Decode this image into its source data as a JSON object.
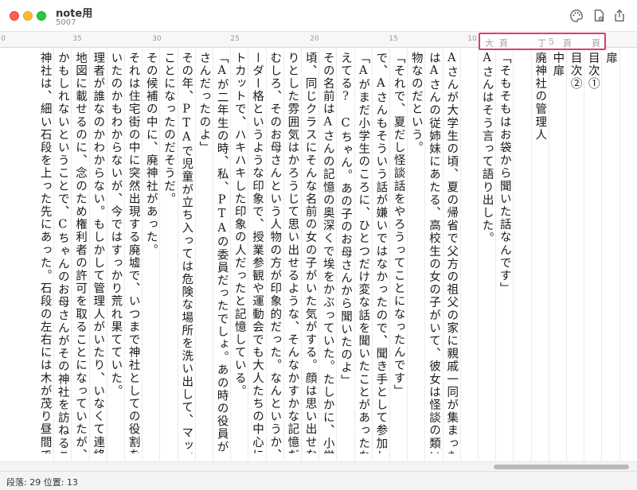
{
  "window": {
    "title": "note用",
    "subtitle": "5007"
  },
  "toolbar": {
    "icons": [
      "palette-icon",
      "document-settings-icon",
      "share-icon"
    ]
  },
  "ruler": {
    "ticks": [
      "0",
      "35",
      "30",
      "25",
      "20",
      "15",
      "10"
    ]
  },
  "page_header": {
    "items": [
      "大",
      "頁",
      "丁",
      "5",
      "頁",
      "頁"
    ]
  },
  "columns": [
    "扉",
    "目次①",
    "目次②",
    "中扉",
    "廃神社の管理人",
    "",
    "「そもそもはお袋から聞いた話なんです」",
    "Aさんはそう言って語り出した。",
    "",
    "Aさんが大学生の頃、夏の帰省で父方の祖父の家に親戚一同が集まった。その中に",
    "はAさんの従姉妹にあたる、高校生の女の子がいて、彼女は怪談の類いのものが大好",
    "物なのだという。",
    "「それで、夏だし怪談話をやろうってことになったんです」",
    "で、Aさんもそういう話が嫌いではなかったので、聞き手として参加した。何番目か",
    "「Aがまだ小学生のころに、ひとつだけ変な話を聞いたことがあったな。ほらA、覚",
    "えてる?　Cちゃん。あの子のお母さんから聞いたのよ」",
    "その名前はAさんの記憶の奥深くで埃をかぶっていた。たしかに、小学校低学年の",
    "頃、同じクラスにそんな名前の女の子がいた気がする。顔は思い出せないが、ぼんや",
    "りとした雰囲気はかろうじて思い出せるような、そんなかすかな記憶だ。",
    "むしろ、そのお母さんという人物の方が印象的だった。なんというか、親たちのリ",
    "ーダー格というような印象で、授業参観や運動会でも大人たちの中心にいた。ショー",
    "トカットで、ハキハキした印象の人だったと記憶している。",
    "「Aが二年生の時、私、PTAの委員だったでしょ。あの時の役員がCちゃんのお母",
    "さんだったのよ」",
    "その年、PTAで児童が立ち入っては危険な場所を洗い出して、マップを作成する",
    "ことになったのだそうだ。",
    "その候補の中に、廃神社があった。",
    "それは住宅街の中に突然出現する廃墟で、いつまで神社としての役割を果たして",
    "いたのかもわからないが、今ではすっかり荒れ果てていた。",
    "理者が誰なのかわからない。もしかして管理人がいたり、いなくて連絡先がわかる",
    "地図に載せるのに、念のため権利者の許可を取ることになっていたが、神社の管",
    "かもしれないということで、Cちゃんのお母さんがその神社を訪ねることになった。",
    "神社は、細い石段を上った先にあった。石段の左右には木が茂り昼間でも薄暗い。"
  ],
  "status": {
    "text": "段落: 29  位置: 13"
  }
}
